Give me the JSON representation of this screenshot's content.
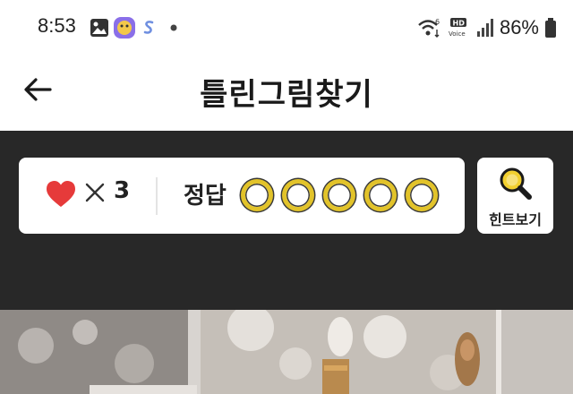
{
  "status_bar": {
    "time": "8:53",
    "battery_percent": "86%",
    "network_label": "HD Voice",
    "icons": [
      "gallery-icon",
      "app-icon",
      "s-icon",
      "dot-icon",
      "wifi-icon",
      "hd-voice-icon",
      "signal-icon",
      "battery-icon"
    ]
  },
  "app_bar": {
    "title": "틀린그림찾기",
    "back_icon": "back-arrow-icon"
  },
  "game_status": {
    "lives_icon": "heart-icon",
    "lives_multiplier": "✕",
    "lives_count": "3",
    "answer_label": "정답",
    "answers_found": 0,
    "answers_total": 5,
    "answer_slots": [
      "",
      "",
      "",
      "",
      ""
    ]
  },
  "hint_button": {
    "label": "힌트보기",
    "icon": "magnifier-icon"
  },
  "colors": {
    "panel_background": "#282828",
    "heart": "#e63a3a",
    "answer_circle": "#e2c32a"
  }
}
